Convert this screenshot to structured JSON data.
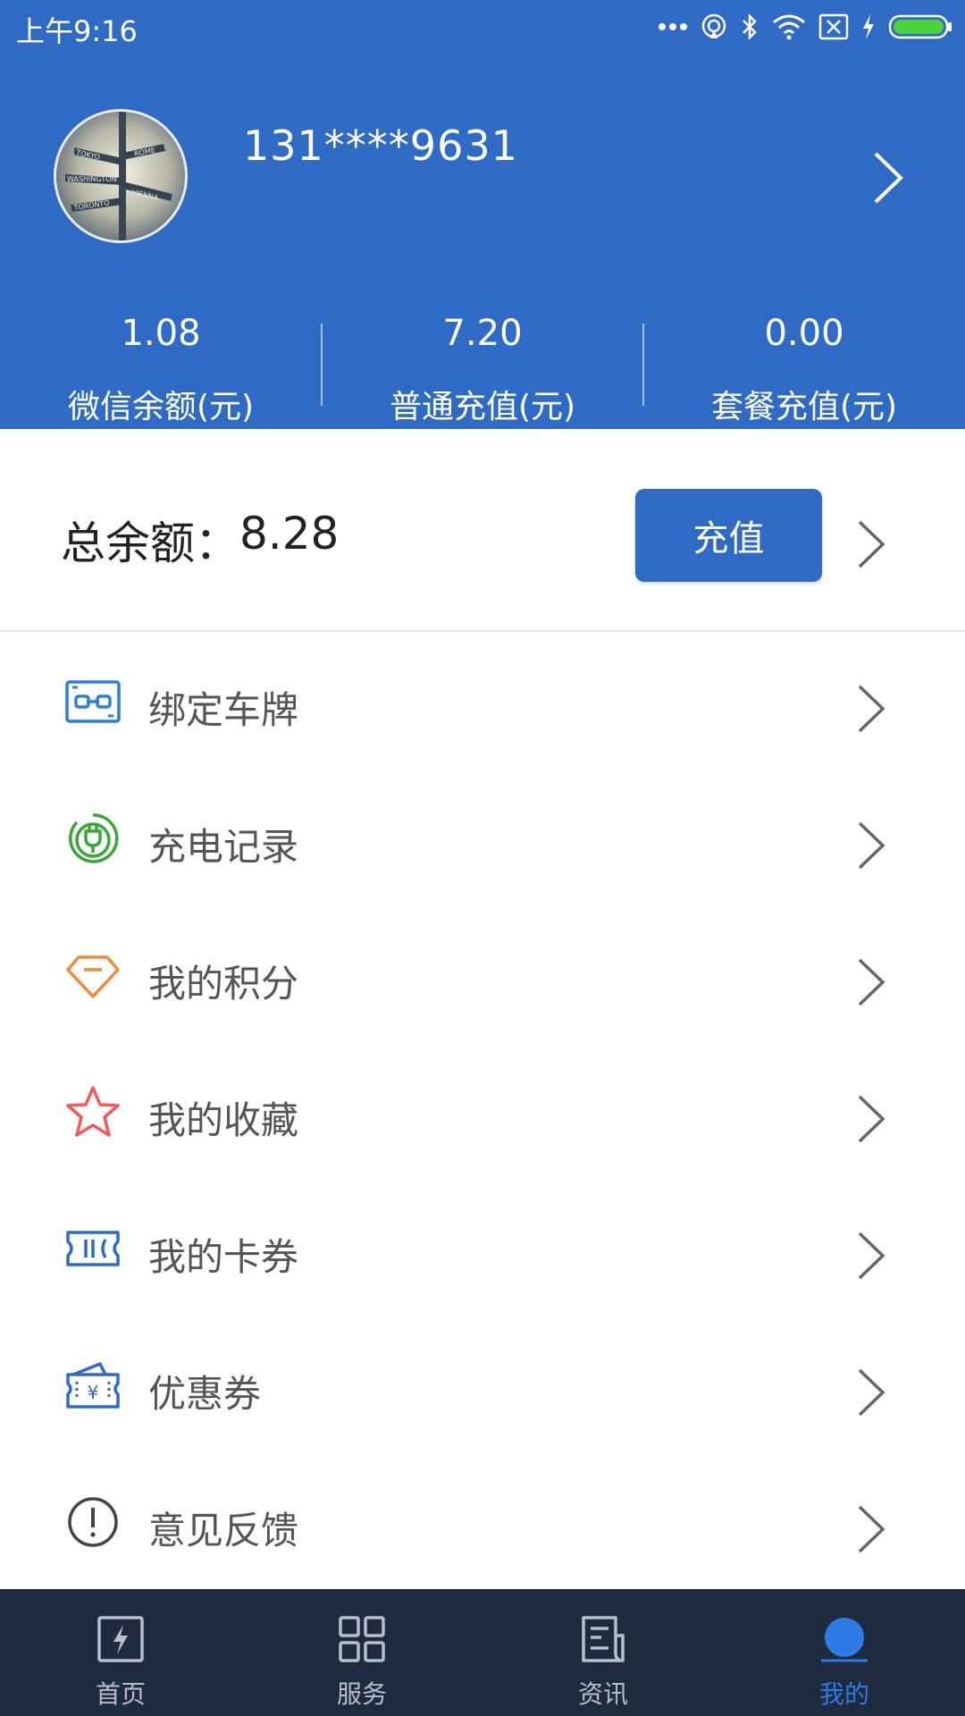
{
  "status_bar": {
    "time": "上午9:16",
    "icons": [
      "more-dots-icon",
      "hotspot-icon",
      "bluetooth-icon",
      "wifi-icon",
      "sim-off-icon",
      "charging-icon",
      "battery-icon"
    ]
  },
  "profile": {
    "avatar_icon": "avatar-image",
    "phone": "131****9631"
  },
  "stats": [
    {
      "value": "1.08",
      "label": "微信余额(元)"
    },
    {
      "value": "7.20",
      "label": "普通充值(元)"
    },
    {
      "value": "0.00",
      "label": "套餐充值(元)"
    }
  ],
  "balance": {
    "label": "总余额：",
    "value": "8.28",
    "recharge_label": "充值"
  },
  "menu": [
    {
      "label": "绑定车牌",
      "icon": "plate-binding-icon",
      "color": "#2f7be6"
    },
    {
      "label": "充电记录",
      "icon": "charging-plug-icon",
      "color": "#3aa63a"
    },
    {
      "label": "我的积分",
      "icon": "diamond-icon",
      "color": "#f08a3c"
    },
    {
      "label": "我的收藏",
      "icon": "star-icon",
      "color": "#ef5a5a"
    },
    {
      "label": "我的卡券",
      "icon": "ticket-icon",
      "color": "#2f6bc4"
    },
    {
      "label": "优惠券",
      "icon": "coupon-icon",
      "color": "#2f6bc4"
    },
    {
      "label": "意见反馈",
      "icon": "exclamation-circle-icon",
      "color": "#444444"
    }
  ],
  "tabs": [
    {
      "label": "首页",
      "icon": "lightning-box-icon"
    },
    {
      "label": "服务",
      "icon": "grid-icon"
    },
    {
      "label": "资讯",
      "icon": "document-icon"
    },
    {
      "label": "我的",
      "icon": "profile-circle-icon",
      "active": true
    }
  ],
  "colors": {
    "primary": "#2f6bc4",
    "tabbar_bg": "#1e2a3e",
    "tab_active": "#2f7be6"
  }
}
